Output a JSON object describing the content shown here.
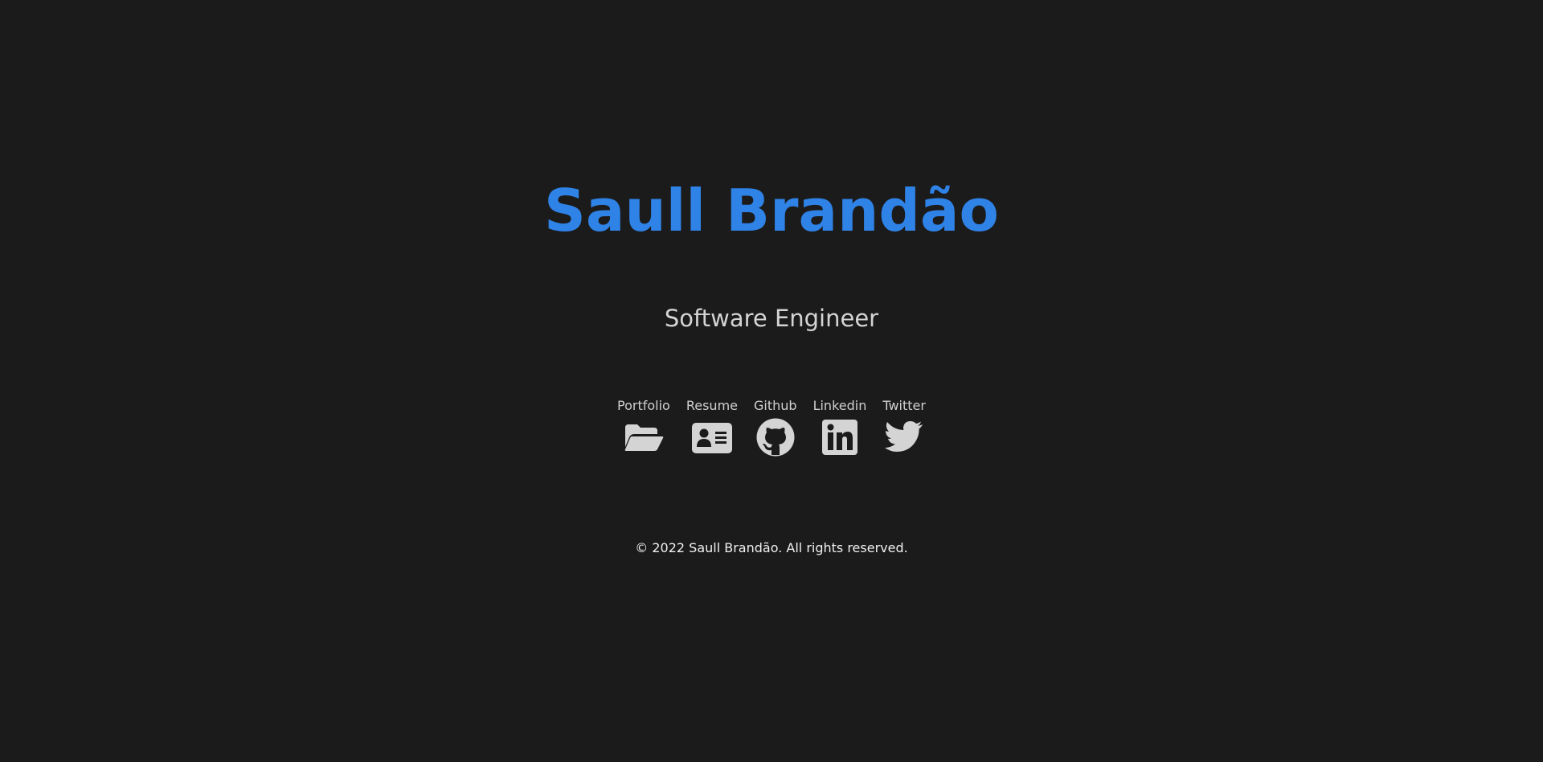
{
  "header": {
    "name": "Saull Brandão",
    "role": "Software Engineer"
  },
  "links": [
    {
      "label": "Portfolio",
      "icon": "folder-open-icon"
    },
    {
      "label": "Resume",
      "icon": "id-card-icon"
    },
    {
      "label": "Github",
      "icon": "github-icon"
    },
    {
      "label": "Linkedin",
      "icon": "linkedin-icon"
    },
    {
      "label": "Twitter",
      "icon": "twitter-icon"
    }
  ],
  "footer": {
    "copyright": "© 2022 Saull Brandão. All rights reserved."
  },
  "colors": {
    "background": "#1b1b1b",
    "accent": "#2f82e6",
    "text": "#d4d4d4"
  }
}
